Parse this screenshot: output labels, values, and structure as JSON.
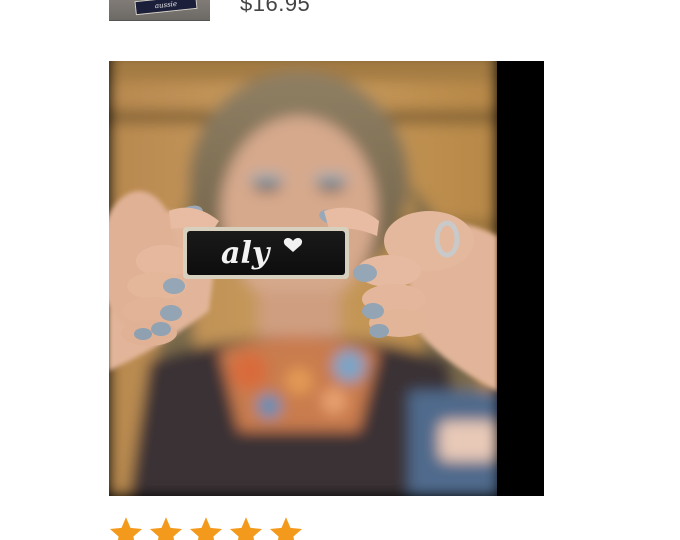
{
  "product": {
    "price": "$16.95",
    "thumbnail_tag_text": "aussie"
  },
  "photo": {
    "name_on_tag": "aly"
  },
  "rating": {
    "stars": 5,
    "max": 5,
    "color": "#f39a1c"
  }
}
